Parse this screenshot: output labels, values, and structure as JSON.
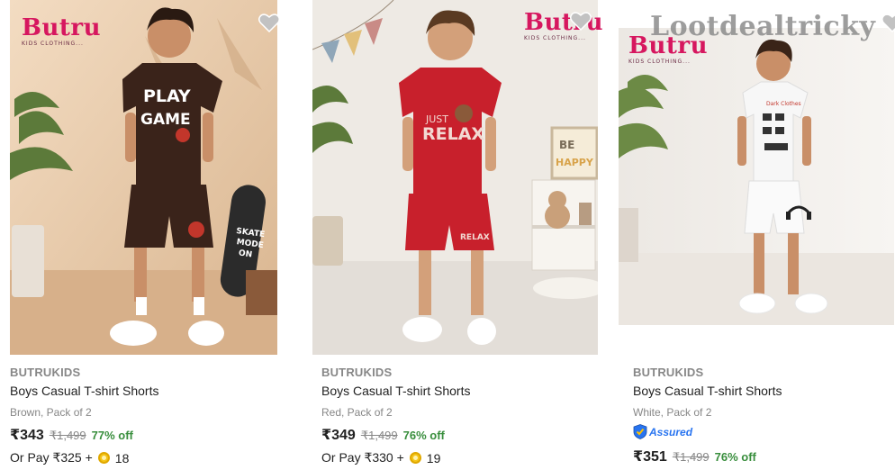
{
  "products": [
    {
      "logo": "Butru",
      "logo_tagline": "KIDS CLOTHING...",
      "brand": "BUTRUKIDS",
      "title": "Boys Casual T-shirt Shorts",
      "variant": "Brown, Pack of 2",
      "price": "₹343",
      "mrp": "₹1,499",
      "discount": "77% off",
      "pay_text": "Or Pay ₹325 +",
      "coins": "18",
      "shirt_text": "PLAY GAME",
      "sign_text": "SKATE MODE ON",
      "colors": {
        "outfit": "#3a231a",
        "bg": "#e8c9a8"
      }
    },
    {
      "logo": "Butru",
      "logo_tagline": "KIDS CLOTHING...",
      "brand": "BUTRUKIDS",
      "title": "Boys Casual T-shirt Shorts",
      "variant": "Red, Pack of 2",
      "price": "₹349",
      "mrp": "₹1,499",
      "discount": "76% off",
      "pay_text": "Or Pay ₹330 +",
      "coins": "19",
      "shirt_text": "JUST RELAX",
      "sign_text": "BE HAPPY",
      "colors": {
        "outfit": "#c8202c",
        "bg": "#eeeae4"
      }
    },
    {
      "logo": "Butru",
      "logo_tagline": "KIDS CLOTHING...",
      "brand": "BUTRUKIDS",
      "title": "Boys Casual T-shirt Shorts",
      "variant": "White, Pack of 2",
      "assured_label": "Assured",
      "price": "₹351",
      "mrp": "₹1,499",
      "discount": "76% off",
      "colors": {
        "outfit": "#f7f7f7",
        "bg": "#f1eeea"
      }
    }
  ],
  "watermark": "Lootdealtricky",
  "icons": {
    "wishlist": "heart-icon",
    "coin": "supercoin-icon",
    "assured": "assured-shield-icon"
  },
  "theme": {
    "discount_green": "#388e3c",
    "muted_grey": "#878787",
    "brand_pink": "#d6175f",
    "assured_blue": "#2874f0"
  }
}
